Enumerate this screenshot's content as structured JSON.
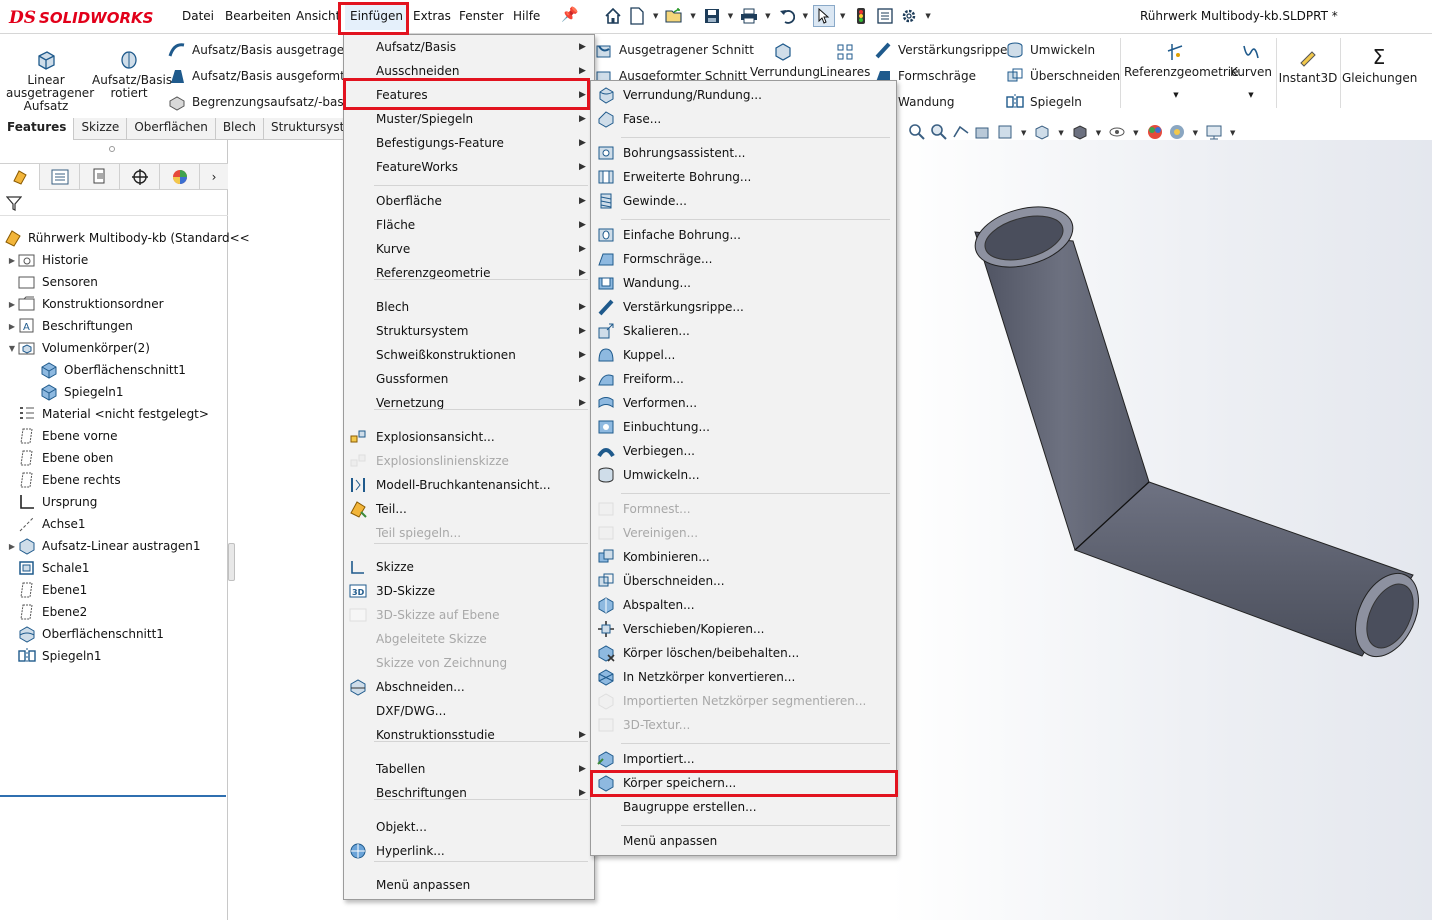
{
  "app": {
    "logo_ds": "DS",
    "logo_text": "SOLIDWORKS",
    "document_title": "Rührwerk Multibody-kb.SLDPRT *"
  },
  "menubar": [
    "Datei",
    "Bearbeiten",
    "Ansicht",
    "Einfügen",
    "Extras",
    "Fenster",
    "Hilfe"
  ],
  "ribbon": {
    "extrude_label": "Linear\nausgetragener\nAufsatz",
    "revolve_label": "Aufsatz/Basis\nrotiert",
    "sweep": "Aufsatz/Basis ausgetragen",
    "loft": "Aufsatz/Basis ausgeformt",
    "boundary": "Begrenzungsaufsatz/-basis",
    "swept_cut": "Ausgetragener Schnitt",
    "lofted_cut": "Ausgeformter Schnitt",
    "fillet": "Verrundung",
    "linear_pattern": "Lineares\nMuster",
    "rib": "Verstärkungsrippe",
    "draft": "Formschräge",
    "shell": "Wandung",
    "wrap": "Umwickeln",
    "intersect": "Überschneiden",
    "mirror": "Spiegeln",
    "ref_geometry": "Referenzgeometrie",
    "curves": "Kurven",
    "instant3d": "Instant3D",
    "equations": "Gleichungen"
  },
  "cm_tabs": [
    "Features",
    "Skizze",
    "Oberflächen",
    "Blech",
    "Struktursystem"
  ],
  "tree": [
    {
      "label": "Rührwerk Multibody-kb  (Standard<<",
      "icon": "part-icon",
      "exp": ""
    },
    {
      "label": "Historie",
      "icon": "history-folder-icon",
      "exp": "▶"
    },
    {
      "label": "Sensoren",
      "icon": "sensors-folder-icon",
      "exp": ""
    },
    {
      "label": "Konstruktionsordner",
      "icon": "design-binder-icon",
      "exp": "▶"
    },
    {
      "label": "Beschriftungen",
      "icon": "annotations-icon",
      "exp": "▶"
    },
    {
      "label": "Volumenkörper(2)",
      "icon": "solid-bodies-folder-icon",
      "exp": "▼"
    },
    {
      "label": "Oberflächenschnitt1",
      "icon": "body-icon",
      "exp": ""
    },
    {
      "label": "Spiegeln1",
      "icon": "body-icon",
      "exp": ""
    },
    {
      "label": "Material <nicht festgelegt>",
      "icon": "material-icon",
      "exp": ""
    },
    {
      "label": "Ebene vorne",
      "icon": "plane-icon",
      "exp": ""
    },
    {
      "label": "Ebene oben",
      "icon": "plane-icon",
      "exp": ""
    },
    {
      "label": "Ebene rechts",
      "icon": "plane-icon",
      "exp": ""
    },
    {
      "label": "Ursprung",
      "icon": "origin-icon",
      "exp": ""
    },
    {
      "label": "Achse1",
      "icon": "axis-icon",
      "exp": ""
    },
    {
      "label": "Aufsatz-Linear austragen1",
      "icon": "extrude-feature-icon",
      "exp": "▶"
    },
    {
      "label": "Schale1",
      "icon": "shell-feature-icon",
      "exp": ""
    },
    {
      "label": "Ebene1",
      "icon": "plane-icon",
      "exp": ""
    },
    {
      "label": "Ebene2",
      "icon": "plane-icon",
      "exp": ""
    },
    {
      "label": "Oberflächenschnitt1",
      "icon": "surface-cut-icon",
      "exp": ""
    },
    {
      "label": "Spiegeln1",
      "icon": "mirror-feature-icon",
      "exp": ""
    }
  ],
  "einfuegen_menu": [
    {
      "label": "Aufsatz/Basis",
      "sub": true
    },
    {
      "label": "Ausschneiden",
      "sub": true
    },
    {
      "label": "Features",
      "sub": true,
      "highlight": true
    },
    {
      "label": "Muster/Spiegeln",
      "sub": true
    },
    {
      "label": "Befestigungs-Feature",
      "sub": true
    },
    {
      "label": "FeatureWorks",
      "sub": true
    },
    {
      "label": "Oberfläche",
      "sub": true
    },
    {
      "label": "Fläche",
      "sub": true
    },
    {
      "label": "Kurve",
      "sub": true
    },
    {
      "label": "Referenzgeometrie",
      "sub": true
    },
    {
      "label": "Blech",
      "sub": true
    },
    {
      "label": "Struktursystem",
      "sub": true
    },
    {
      "label": "Schweißkonstruktionen",
      "sub": true
    },
    {
      "label": "Gussformen",
      "sub": true
    },
    {
      "label": "Vernetzung",
      "sub": true
    },
    {
      "label": "Explosionsansicht...",
      "icon": "explode-view-icon"
    },
    {
      "label": "Explosionslinienskizze",
      "icon": "explode-line-icon",
      "disabled": true
    },
    {
      "label": "Modell-Bruchkantenansicht...",
      "icon": "break-view-icon"
    },
    {
      "label": "Teil...",
      "icon": "insert-part-icon"
    },
    {
      "label": "Teil spiegeln...",
      "disabled": true
    },
    {
      "label": "Skizze",
      "icon": "sketch-icon"
    },
    {
      "label": "3D-Skizze",
      "icon": "sketch-3d-icon"
    },
    {
      "label": "3D-Skizze auf Ebene",
      "icon": "sketch-3d-plane-icon",
      "disabled": true
    },
    {
      "label": "Abgeleitete Skizze",
      "disabled": true
    },
    {
      "label": "Skizze von Zeichnung",
      "disabled": true
    },
    {
      "label": "Abschneiden...",
      "icon": "split-icon"
    },
    {
      "label": "DXF/DWG..."
    },
    {
      "label": "Konstruktionsstudie",
      "sub": true
    },
    {
      "label": "Tabellen",
      "sub": true
    },
    {
      "label": "Beschriftungen",
      "sub": true
    },
    {
      "label": "Objekt..."
    },
    {
      "label": "Hyperlink...",
      "icon": "hyperlink-icon"
    },
    {
      "label": "Menü anpassen"
    }
  ],
  "features_menu": [
    {
      "label": "Verrundung/Rundung...",
      "icon": "fillet-icon"
    },
    {
      "label": "Fase...",
      "icon": "chamfer-icon"
    },
    {
      "label": "Bohrungsassistent...",
      "icon": "hole-wizard-icon"
    },
    {
      "label": "Erweiterte Bohrung...",
      "icon": "advanced-hole-icon"
    },
    {
      "label": "Gewinde...",
      "icon": "thread-icon"
    },
    {
      "label": "Einfache Bohrung...",
      "icon": "simple-hole-icon"
    },
    {
      "label": "Formschräge...",
      "icon": "draft-icon"
    },
    {
      "label": "Wandung...",
      "icon": "shell-icon"
    },
    {
      "label": "Verstärkungsrippe...",
      "icon": "rib-icon"
    },
    {
      "label": "Skalieren...",
      "icon": "scale-icon"
    },
    {
      "label": "Kuppel...",
      "icon": "dome-icon"
    },
    {
      "label": "Freiform...",
      "icon": "freeform-icon"
    },
    {
      "label": "Verformen...",
      "icon": "deform-icon"
    },
    {
      "label": "Einbuchtung...",
      "icon": "indent-icon"
    },
    {
      "label": "Verbiegen...",
      "icon": "flex-icon"
    },
    {
      "label": "Umwickeln...",
      "icon": "wrap-icon"
    },
    {
      "label": "Formnest...",
      "icon": "cavity-icon",
      "disabled": true
    },
    {
      "label": "Vereinigen...",
      "icon": "join-icon",
      "disabled": true
    },
    {
      "label": "Kombinieren...",
      "icon": "combine-icon"
    },
    {
      "label": "Überschneiden...",
      "icon": "intersect-icon"
    },
    {
      "label": "Abspalten...",
      "icon": "split-body-icon"
    },
    {
      "label": "Verschieben/Kopieren...",
      "icon": "move-copy-icon"
    },
    {
      "label": "Körper löschen/beibehalten...",
      "icon": "delete-body-icon"
    },
    {
      "label": "In Netzkörper konvertieren...",
      "icon": "convert-mesh-icon"
    },
    {
      "label": "Importierten Netzkörper segmentieren...",
      "icon": "segment-mesh-icon",
      "disabled": true
    },
    {
      "label": "3D-Textur...",
      "icon": "texture-3d-icon",
      "disabled": true
    },
    {
      "label": "Importiert...",
      "icon": "imported-icon"
    },
    {
      "label": "Körper speichern...",
      "icon": "save-bodies-icon",
      "boxed": true
    },
    {
      "label": "Baugruppe erstellen..."
    },
    {
      "label": "Menü anpassen"
    }
  ],
  "colors": {
    "highlight_box": "#e2131f",
    "accent": "#2f6fb0",
    "brand": "#e2001a",
    "tube": "#5f6371"
  }
}
